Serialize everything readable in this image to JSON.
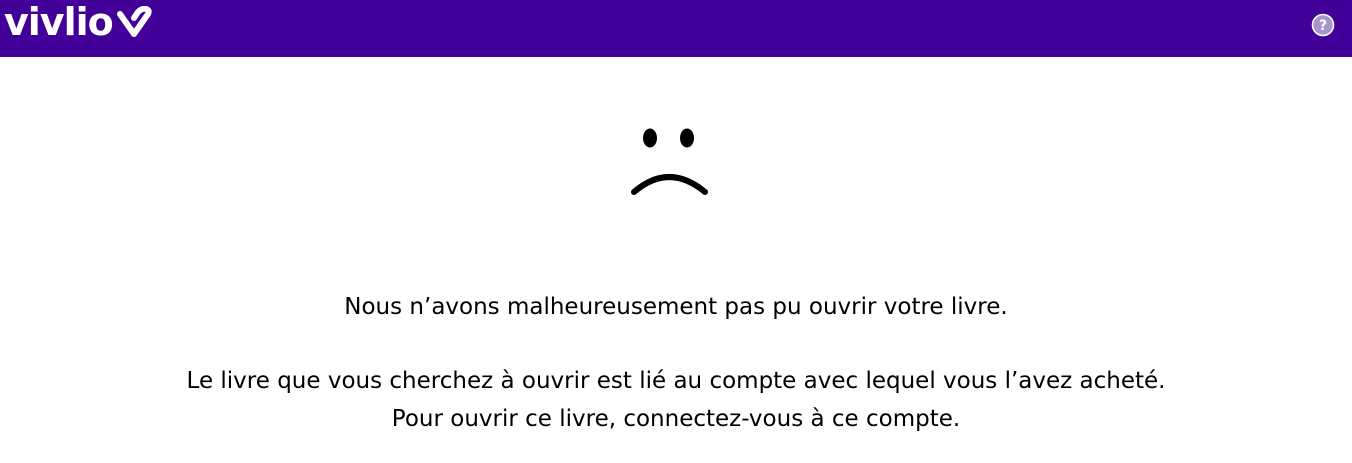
{
  "header": {
    "logo_text": "vivlio",
    "logo_mark_icon": "vivlio-check-mark-icon",
    "help_icon": "help-question-icon",
    "background_color": "#430098"
  },
  "error": {
    "icon": "sad-face-icon",
    "title": "Nous n’avons malheureusement pas pu ouvrir votre livre.",
    "detail_line1": "Le livre que vous cherchez à ouvrir est lié au compte avec lequel vous l’avez acheté.",
    "detail_line2": "Pour ouvrir ce livre, connectez-vous à ce compte."
  }
}
